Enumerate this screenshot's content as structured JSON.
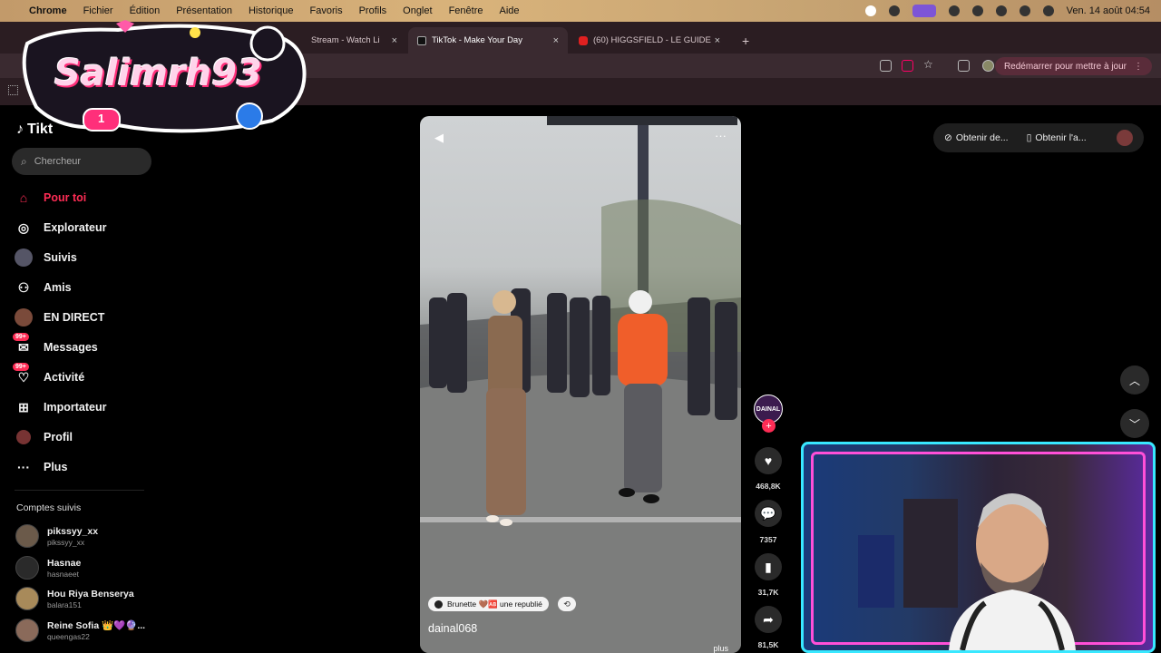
{
  "menubar": {
    "app": "Chrome",
    "items": [
      "Fichier",
      "Édition",
      "Présentation",
      "Historique",
      "Favoris",
      "Profils",
      "Onglet",
      "Fenêtre",
      "Aide"
    ],
    "datetime": "Ven. 14 août 04:54"
  },
  "tabs": [
    {
      "label": "Stream - Watch Li",
      "close": "×"
    },
    {
      "label": "TikTok - Make Your Day",
      "close": "×"
    },
    {
      "label": "(60) HIGGSFIELD - LE GUIDE",
      "close": "×"
    }
  ],
  "new_tab": "+",
  "toolbar": {
    "restart_label": "Redémarrer pour mettre à jour"
  },
  "overlay": {
    "logo_text": "Salimrh93",
    "logo_badge": "1"
  },
  "sidebar": {
    "brand": "Tikt",
    "search_placeholder": "Chercheur",
    "nav": [
      {
        "label": "Pour toi",
        "icon": "home-icon"
      },
      {
        "label": "Explorateur",
        "icon": "compass-icon"
      },
      {
        "label": "Suivis",
        "icon": "following-icon"
      },
      {
        "label": "Amis",
        "icon": "friends-icon"
      },
      {
        "label": "EN DIRECT",
        "icon": "live-icon"
      },
      {
        "label": "Messages",
        "icon": "messages-icon",
        "badge": "99+"
      },
      {
        "label": "Activité",
        "icon": "activity-icon",
        "badge": "99+"
      },
      {
        "label": "Importateur",
        "icon": "upload-icon"
      },
      {
        "label": "Profil",
        "icon": "profile-icon"
      },
      {
        "label": "Plus",
        "icon": "more-icon"
      }
    ],
    "followed_title": "Comptes suivis",
    "accounts": [
      {
        "name": "pikssyy_xx",
        "handle": "pikssyy_xx"
      },
      {
        "name": "Hasnae",
        "handle": "hasnaeet"
      },
      {
        "name": "Hou Riya Benserya",
        "handle": "balara151"
      },
      {
        "name": "Reine Sofia 👑💜🔮...",
        "handle": "queengas22"
      }
    ]
  },
  "video": {
    "username": "dainal068",
    "tag_text": "Brunette 🤎🆎 une republié",
    "more": "plus"
  },
  "actions": {
    "creator_avatar_text": "DAINAL",
    "likes": "468,8K",
    "comments": "7357",
    "saves": "31,7K",
    "shares": "81,5K"
  },
  "topright": {
    "btn1": "Obtenir de...",
    "btn2": "Obtenir l'a..."
  },
  "colors": {
    "accent": "#fe2c55",
    "webcam_outer": "#38e8ff",
    "webcam_inner": "#ff4fd8"
  }
}
